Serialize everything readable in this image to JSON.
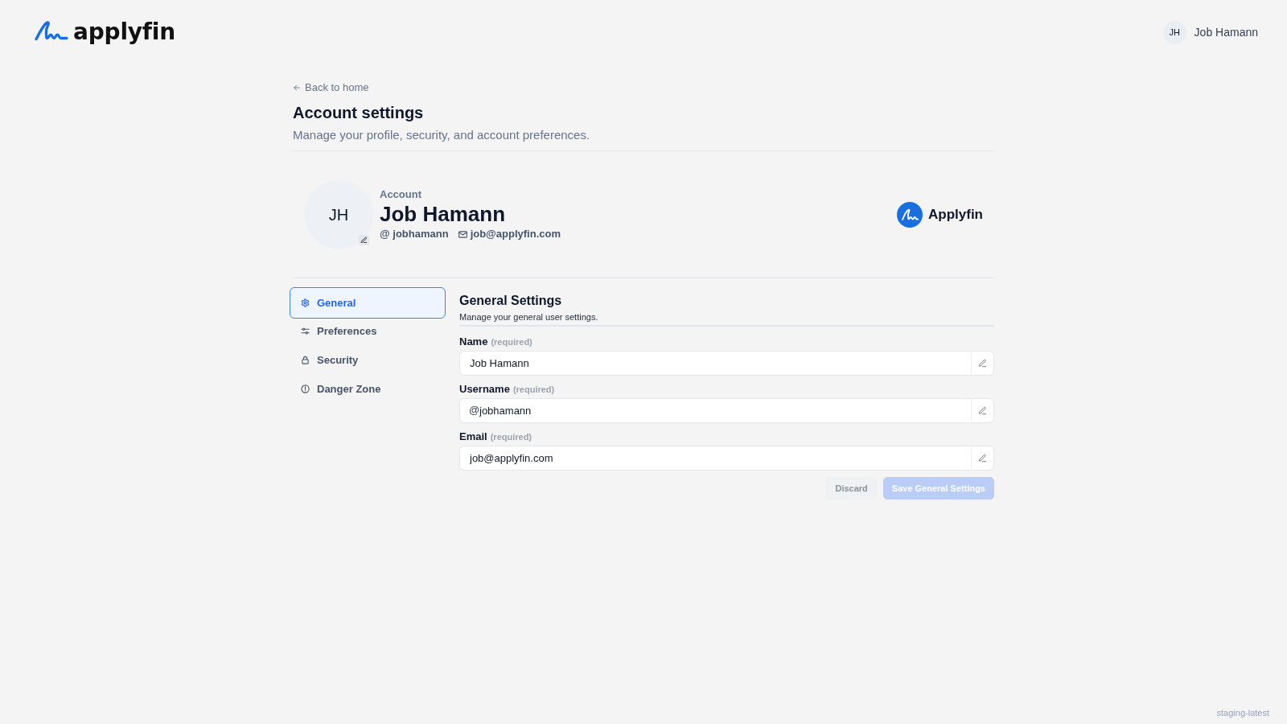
{
  "header": {
    "brand": "applyfin",
    "user": {
      "initials": "JH",
      "name": "Job Hamann"
    }
  },
  "back_link": "Back to home",
  "page": {
    "title": "Account settings",
    "subtitle": "Manage your profile, security, and account preferences."
  },
  "profile": {
    "initials": "JH",
    "label": "Account",
    "name": "Job Hamann",
    "username": "@ jobhamann",
    "email": "job@applyfin.com",
    "organization": "Applyfin"
  },
  "nav": [
    {
      "label": "General",
      "selected": true
    },
    {
      "label": "Preferences",
      "selected": false
    },
    {
      "label": "Security",
      "selected": false
    },
    {
      "label": "Danger Zone",
      "selected": false
    }
  ],
  "section": {
    "title": "General Settings",
    "subtitle": "Manage your general user settings."
  },
  "fields": [
    {
      "label": "Name",
      "hint": "(required)",
      "value": "Job Hamann"
    },
    {
      "label": "Username",
      "hint": "(required)",
      "prefix": "@",
      "value": "jobhamann"
    },
    {
      "label": "Email",
      "hint": "(required)",
      "value": "job@applyfin.com"
    }
  ],
  "buttons": [
    {
      "label": "Discard",
      "kind": "secondary",
      "disabled": true
    },
    {
      "label": "Save General Settings",
      "kind": "primary",
      "disabled": true
    }
  ],
  "footer": {
    "version": "staging-latest"
  }
}
